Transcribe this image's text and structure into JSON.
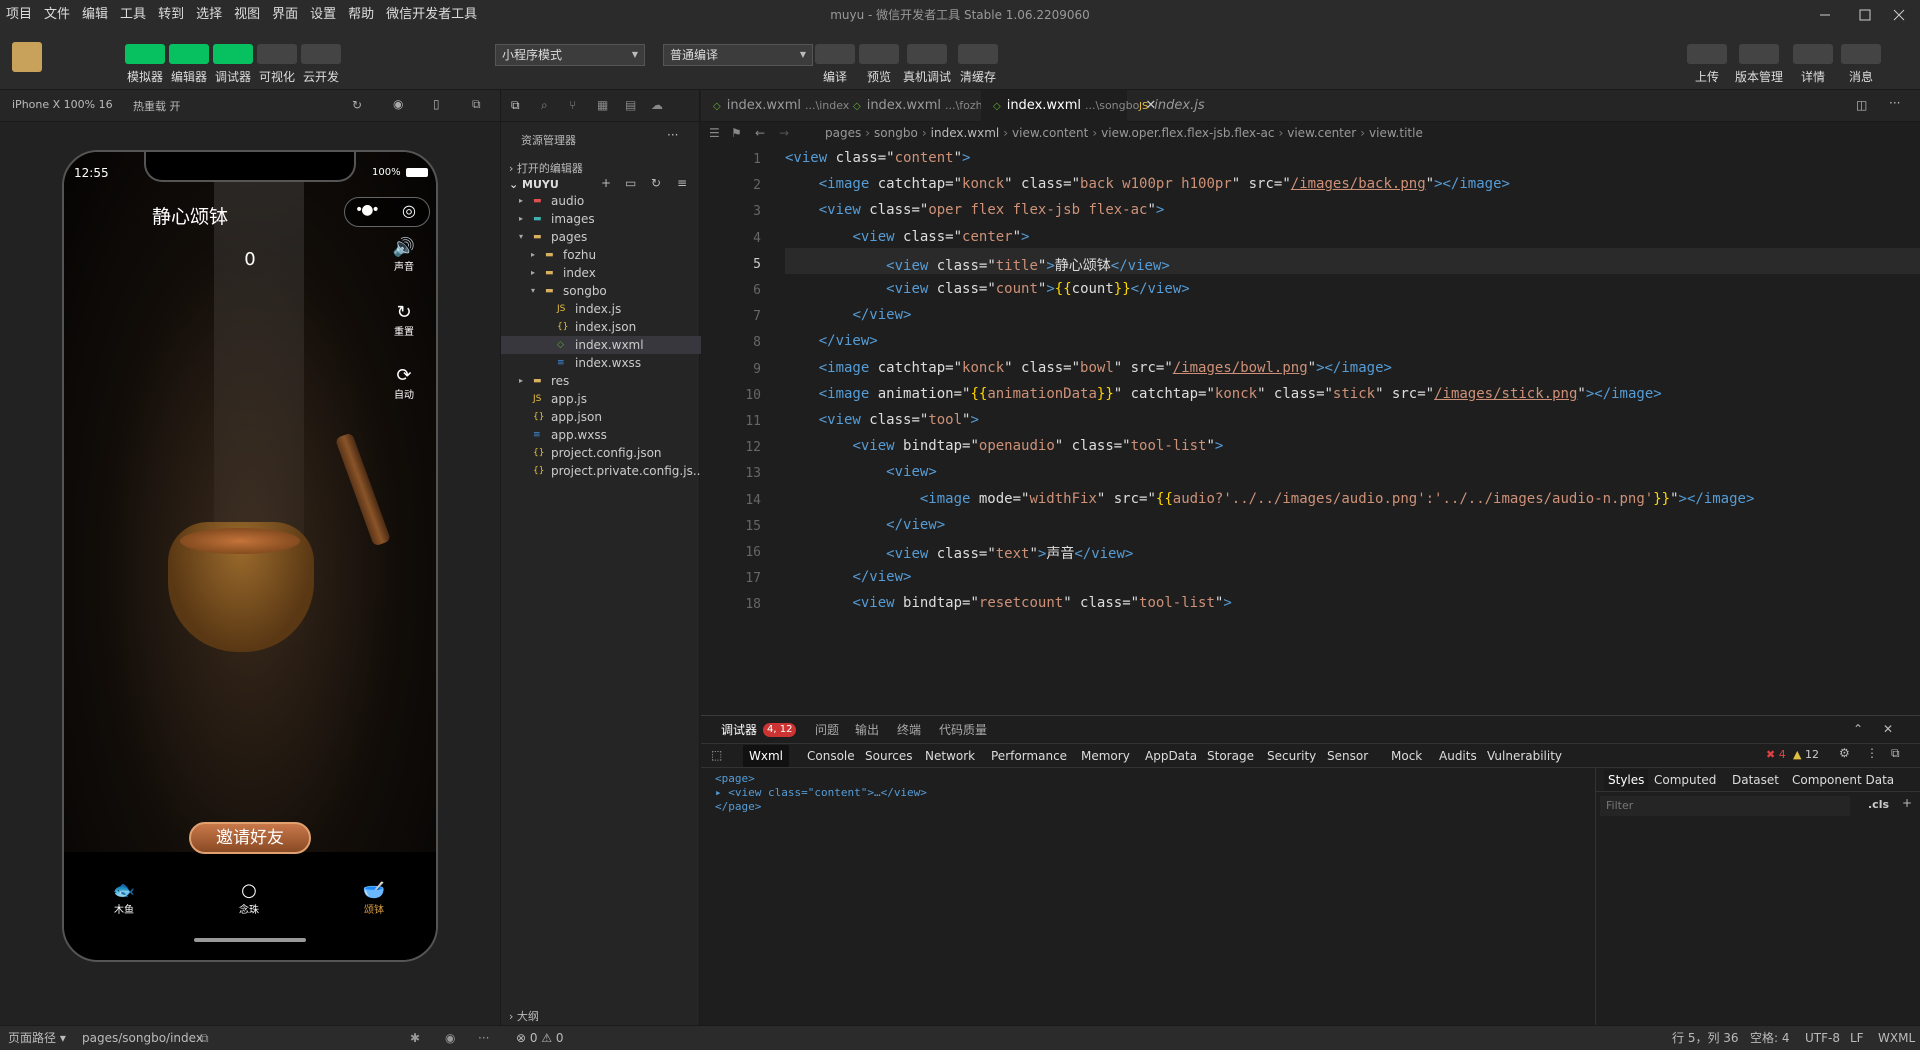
{
  "menu": [
    "项目",
    "文件",
    "编辑",
    "工具",
    "转到",
    "选择",
    "视图",
    "界面",
    "设置",
    "帮助",
    "微信开发者工具"
  ],
  "window_title": "muyu - 微信开发者工具 Stable 1.06.2209060",
  "toolbar": {
    "left": [
      "模拟器",
      "编辑器",
      "调试器",
      "可视化",
      "云开发"
    ],
    "mode_select": "小程序模式",
    "compile_select": "普通编译",
    "center": [
      "编译",
      "预览",
      "真机调试",
      "清缓存"
    ],
    "right": [
      "上传",
      "版本管理",
      "详情",
      "消息"
    ]
  },
  "simbar": {
    "device": "iPhone X 100% 16",
    "hot_reload": "热重载 开"
  },
  "phone": {
    "time": "12:55",
    "battery": "100%",
    "title": "静心颂钵",
    "count": "0",
    "side": [
      "声音",
      "重置",
      "自动"
    ],
    "invite": "邀请好友",
    "tabs": [
      "木鱼",
      "念珠",
      "颂钵"
    ]
  },
  "explorer": {
    "header": "资源管理器",
    "open_editors": "打开的编辑器",
    "project": "MUYU",
    "outline": "大纲",
    "items": [
      {
        "name": "audio",
        "depth": 1,
        "type": "folder-red"
      },
      {
        "name": "images",
        "depth": 1,
        "type": "folder-teal"
      },
      {
        "name": "pages",
        "depth": 1,
        "type": "folder-open"
      },
      {
        "name": "fozhu",
        "depth": 2,
        "type": "folder"
      },
      {
        "name": "index",
        "depth": 2,
        "type": "folder"
      },
      {
        "name": "songbo",
        "depth": 2,
        "type": "folder-open"
      },
      {
        "name": "index.js",
        "depth": 3,
        "type": "js"
      },
      {
        "name": "index.json",
        "depth": 3,
        "type": "json"
      },
      {
        "name": "index.wxml",
        "depth": 3,
        "type": "wxml",
        "active": true
      },
      {
        "name": "index.wxss",
        "depth": 3,
        "type": "wxss"
      },
      {
        "name": "res",
        "depth": 1,
        "type": "folder"
      },
      {
        "name": "app.js",
        "depth": 1,
        "type": "js"
      },
      {
        "name": "app.json",
        "depth": 1,
        "type": "json"
      },
      {
        "name": "app.wxss",
        "depth": 1,
        "type": "wxss"
      },
      {
        "name": "project.config.json",
        "depth": 1,
        "type": "json"
      },
      {
        "name": "project.private.config.js...",
        "depth": 1,
        "type": "json"
      }
    ]
  },
  "tabs": [
    {
      "name": "index.wxml",
      "path": "...\\index"
    },
    {
      "name": "index.wxml",
      "path": "...\\fozhu"
    },
    {
      "name": "index.wxml",
      "path": "...\\songbo",
      "active": true
    },
    {
      "name": "index.js",
      "path": ""
    }
  ],
  "breadcrumb": [
    "pages",
    "songbo",
    "index.wxml",
    "view.content",
    "view.oper.flex.flex-jsb.flex-ac",
    "view.center",
    "view.title"
  ],
  "code": [
    "<view class=\"content\">",
    "    <image catchtap=\"konck\" class=\"back w100pr h100pr\" src=\"/images/back.png\"></image>",
    "    <view class=\"oper flex flex-jsb flex-ac\">",
    "        <view class=\"center\">",
    "            <view class=\"title\">静心颂钵</view>",
    "            <view class=\"count\">{{count}}</view>",
    "        </view>",
    "    </view>",
    "    <image catchtap=\"konck\" class=\"bowl\" src=\"/images/bowl.png\"></image>",
    "    <image animation=\"{{animationData}}\" catchtap=\"konck\" class=\"stick\" src=\"/images/stick.png\"></image>",
    "    <view class=\"tool\">",
    "        <view bindtap=\"openaudio\" class=\"tool-list\">",
    "            <view>",
    "                <image mode=\"widthFix\" src=\"{{audio?'../../images/audio.png':'../../images/audio-n.png'}}\"></image>",
    "            </view>",
    "            <view class=\"text\">声音</view>",
    "        </view>",
    "        <view bindtap=\"resetcount\" class=\"tool-list\">"
  ],
  "debug": {
    "tabs": [
      "调试器",
      "问题",
      "输出",
      "终端",
      "代码质量"
    ],
    "badge": "4, 12",
    "devtabs": [
      "Wxml",
      "Console",
      "Sources",
      "Network",
      "Performance",
      "Memory",
      "AppData",
      "Storage",
      "Security",
      "Sensor",
      "Mock",
      "Audits",
      "Vulnerability"
    ],
    "errors": "4",
    "warnings": "12",
    "wxml": [
      "<page>",
      "<view class=\"content\">…</view>",
      "</page>"
    ],
    "side_tabs": [
      "Styles",
      "Computed",
      "Dataset",
      "Component Data"
    ],
    "filter_placeholder": "Filter",
    "cls": ".cls"
  },
  "status": {
    "path_label": "页面路径",
    "path": "pages/songbo/index",
    "problems": "0",
    "warnings": "0",
    "cursor": "行 5，列 36",
    "spaces": "空格: 4",
    "encoding": "UTF-8",
    "eol": "LF",
    "lang": "WXML"
  }
}
